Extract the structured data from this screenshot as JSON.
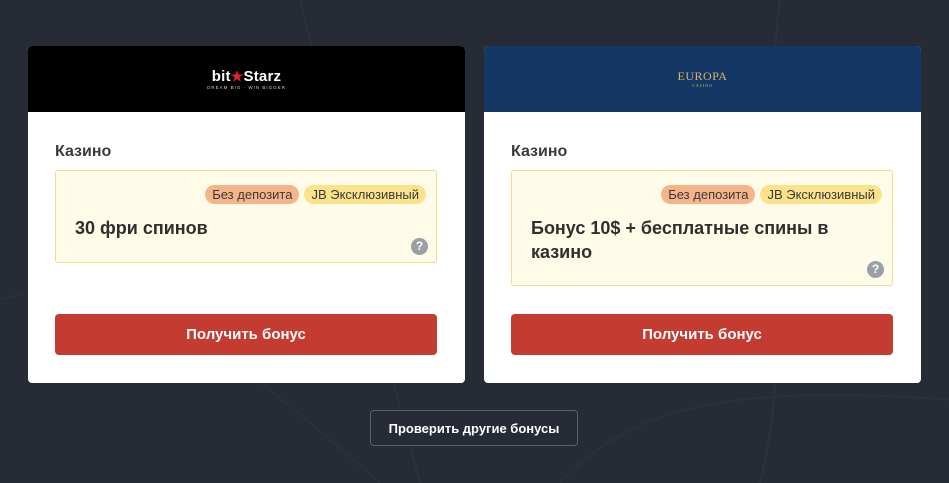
{
  "cards": [
    {
      "brand": {
        "logo_main_a": "bit",
        "logo_main_b": "Starz",
        "logo_tagline": "DREAM BIG · WIN BIGGER"
      },
      "category": "Казино",
      "badges": {
        "no_deposit": "Без депозита",
        "exclusive": "JB Эксклюзивный"
      },
      "offer": "30 фри спинов",
      "help": "?",
      "cta": "Получить бонус"
    },
    {
      "brand": {
        "logo_main": "EUROPA",
        "logo_tagline": "CASINO"
      },
      "category": "Казино",
      "badges": {
        "no_deposit": "Без депозита",
        "exclusive": "JB Эксклюзивный"
      },
      "offer": "Бонус 10$ + бесплатные спины в казино",
      "help": "?",
      "cta": "Получить бонус"
    }
  ],
  "more_button": "Проверить другие бонусы",
  "colors": {
    "page_bg": "#262b35",
    "card1_header": "#000000",
    "card2_header": "#143765",
    "cta": "#c33b31",
    "badge_no_deposit": "#f5b48a",
    "badge_exclusive": "#fbe38c",
    "offer_box": "#fffbe9"
  }
}
